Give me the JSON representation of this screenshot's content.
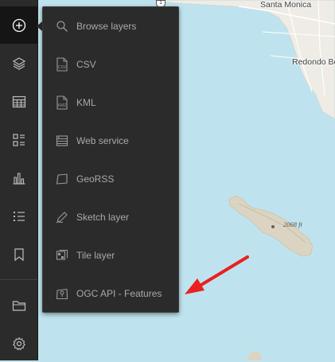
{
  "map": {
    "places": [
      {
        "name": "santa-monica",
        "label": "Santa Monica"
      },
      {
        "name": "redondo-beach",
        "label": "Redondo Be"
      }
    ],
    "elevation_label": "2068 ft",
    "route_shield": "1",
    "colors": {
      "water": "#bfe3ee",
      "land": "#eeece4",
      "island": "#dcd4c2",
      "annotation_arrow": "#e8211f"
    }
  },
  "toolbar": {
    "items": [
      {
        "name": "add-button",
        "icon": "add-circle-icon"
      },
      {
        "name": "layers-button",
        "icon": "layers-icon"
      },
      {
        "name": "table-button",
        "icon": "table-icon"
      },
      {
        "name": "legend-button",
        "icon": "legend-icon"
      },
      {
        "name": "charts-button",
        "icon": "bar-chart-icon"
      },
      {
        "name": "list-button",
        "icon": "list-icon"
      },
      {
        "name": "bookmarks-button",
        "icon": "bookmark-icon"
      },
      {
        "name": "open-button",
        "icon": "folder-icon"
      },
      {
        "name": "settings-button",
        "icon": "gear-icon"
      }
    ]
  },
  "add_menu": {
    "items": [
      {
        "name": "browse-layers",
        "label": "Browse layers",
        "icon": "search-icon"
      },
      {
        "name": "csv",
        "label": "CSV",
        "icon": "csv-file-icon"
      },
      {
        "name": "kml",
        "label": "KML",
        "icon": "kml-file-icon"
      },
      {
        "name": "web-service",
        "label": "Web service",
        "icon": "web-service-icon"
      },
      {
        "name": "georss",
        "label": "GeoRSS",
        "icon": "georss-icon"
      },
      {
        "name": "sketch-layer",
        "label": "Sketch layer",
        "icon": "sketch-icon"
      },
      {
        "name": "tile-layer",
        "label": "Tile layer",
        "icon": "tile-layer-icon"
      },
      {
        "name": "ogc-api-features",
        "label": "OGC API - Features",
        "icon": "ogc-features-icon"
      }
    ]
  }
}
